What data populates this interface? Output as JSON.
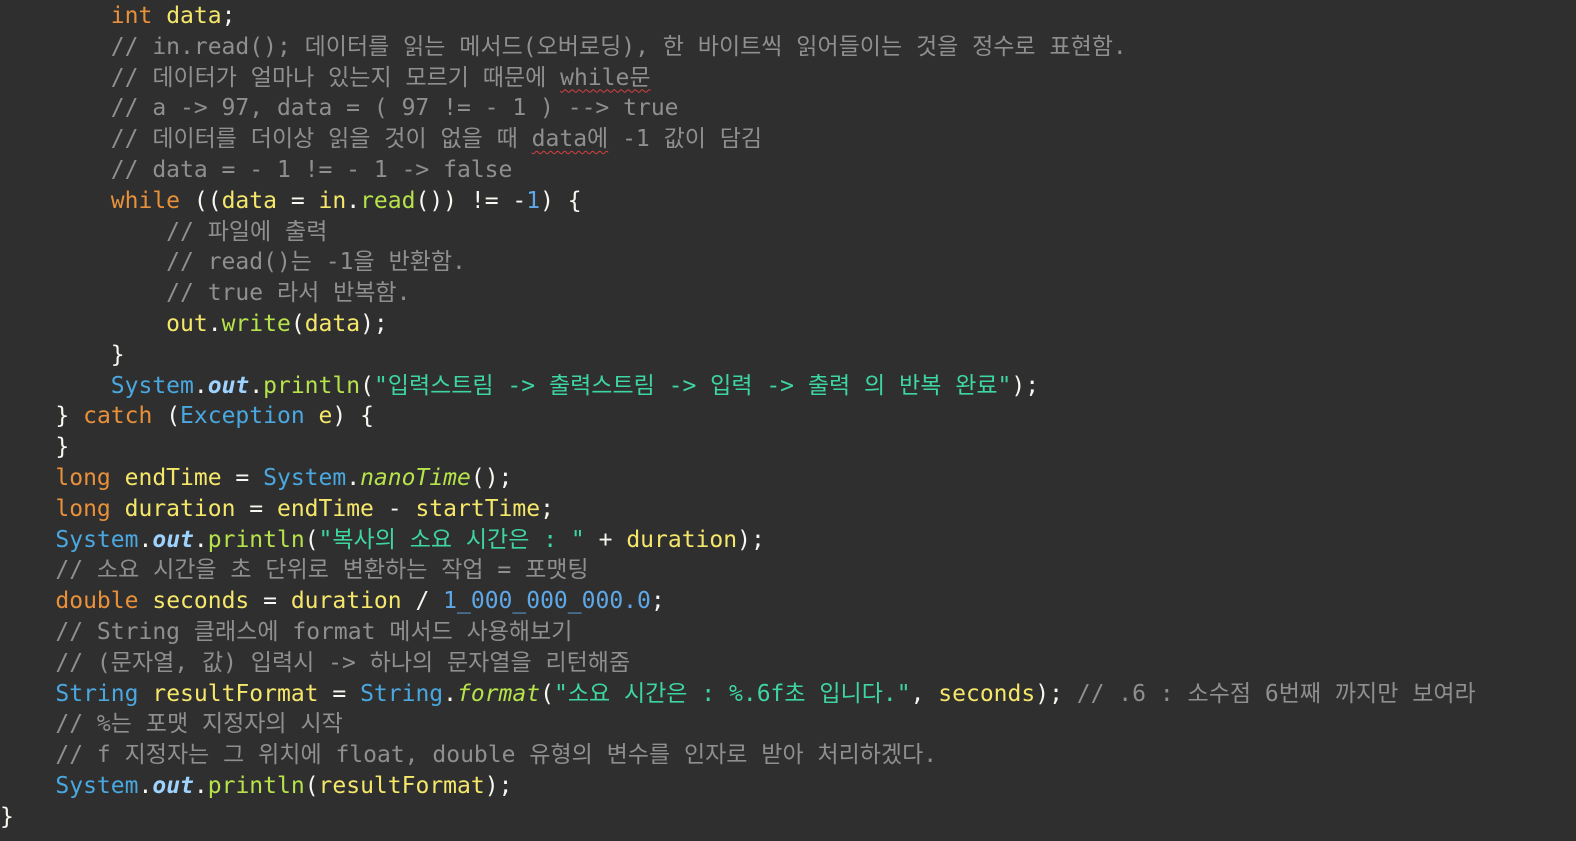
{
  "editor": {
    "lines": [
      {
        "indent": "        ",
        "tokens": [
          {
            "t": "int",
            "c": "kw"
          },
          {
            "t": " ",
            "c": "punc"
          },
          {
            "t": "data",
            "c": "var"
          },
          {
            "t": ";",
            "c": "punc"
          }
        ]
      },
      {
        "indent": "        ",
        "tokens": [
          {
            "t": "// in.read(); 데이터를 읽는 메서드(오버로딩), 한 바이트씩 읽어들이는 것을 정수로 표현함.",
            "c": "cmt"
          }
        ]
      },
      {
        "indent": "        ",
        "tokens": [
          {
            "t": "// 데이터가 얼마나 있는지 모르기 때문에 ",
            "c": "cmt"
          },
          {
            "t": "while문",
            "c": "cmt err"
          }
        ]
      },
      {
        "indent": "        ",
        "tokens": [
          {
            "t": "// a -> 97, data = ( 97 != - 1 ) --> true",
            "c": "cmt"
          }
        ]
      },
      {
        "indent": "        ",
        "tokens": [
          {
            "t": "// 데이터를 더이상 읽을 것이 없을 때 ",
            "c": "cmt"
          },
          {
            "t": "data에",
            "c": "cmt err"
          },
          {
            "t": " -1 값이 담김",
            "c": "cmt"
          }
        ]
      },
      {
        "indent": "        ",
        "tokens": [
          {
            "t": "// data = - 1 != - 1 -> false",
            "c": "cmt"
          }
        ]
      },
      {
        "indent": "        ",
        "tokens": [
          {
            "t": "while",
            "c": "kw"
          },
          {
            "t": " ((",
            "c": "punc"
          },
          {
            "t": "data",
            "c": "var"
          },
          {
            "t": " = ",
            "c": "punc"
          },
          {
            "t": "in",
            "c": "var"
          },
          {
            "t": ".",
            "c": "punc"
          },
          {
            "t": "read",
            "c": "meth"
          },
          {
            "t": "()) != -",
            "c": "punc"
          },
          {
            "t": "1",
            "c": "num"
          },
          {
            "t": ") {",
            "c": "punc"
          }
        ]
      },
      {
        "indent": "            ",
        "tokens": [
          {
            "t": "// 파일에 출력",
            "c": "cmt"
          }
        ]
      },
      {
        "indent": "            ",
        "tokens": [
          {
            "t": "// read()는 -1을 반환함.",
            "c": "cmt"
          }
        ]
      },
      {
        "indent": "            ",
        "tokens": [
          {
            "t": "// true 라서 반복함.",
            "c": "cmt"
          }
        ]
      },
      {
        "indent": "            ",
        "tokens": [
          {
            "t": "out",
            "c": "var"
          },
          {
            "t": ".",
            "c": "punc"
          },
          {
            "t": "write",
            "c": "meth"
          },
          {
            "t": "(",
            "c": "punc"
          },
          {
            "t": "data",
            "c": "var"
          },
          {
            "t": ");",
            "c": "punc"
          }
        ]
      },
      {
        "indent": "        ",
        "tokens": [
          {
            "t": "}",
            "c": "punc"
          }
        ]
      },
      {
        "indent": "        ",
        "tokens": [
          {
            "t": "System",
            "c": "type"
          },
          {
            "t": ".",
            "c": "punc"
          },
          {
            "t": "out",
            "c": "fld"
          },
          {
            "t": ".",
            "c": "punc"
          },
          {
            "t": "println",
            "c": "meth"
          },
          {
            "t": "(",
            "c": "punc"
          },
          {
            "t": "\"입력스트림 -> 출력스트림 -> 입력 -> 출력 의 반복 완료\"",
            "c": "str"
          },
          {
            "t": ");",
            "c": "punc"
          }
        ]
      },
      {
        "indent": "    ",
        "tokens": [
          {
            "t": "} ",
            "c": "punc"
          },
          {
            "t": "catch",
            "c": "kw"
          },
          {
            "t": " (",
            "c": "punc"
          },
          {
            "t": "Exception",
            "c": "type"
          },
          {
            "t": " ",
            "c": "punc"
          },
          {
            "t": "e",
            "c": "var"
          },
          {
            "t": ") {",
            "c": "punc"
          }
        ]
      },
      {
        "indent": "    ",
        "tokens": [
          {
            "t": "}",
            "c": "punc"
          }
        ]
      },
      {
        "indent": "    ",
        "tokens": [
          {
            "t": "long",
            "c": "kw"
          },
          {
            "t": " ",
            "c": "punc"
          },
          {
            "t": "endTime",
            "c": "var"
          },
          {
            "t": " = ",
            "c": "punc"
          },
          {
            "t": "System",
            "c": "type"
          },
          {
            "t": ".",
            "c": "punc"
          },
          {
            "t": "nanoTime",
            "c": "smeth"
          },
          {
            "t": "();",
            "c": "punc"
          }
        ]
      },
      {
        "indent": "    ",
        "tokens": [
          {
            "t": "long",
            "c": "kw"
          },
          {
            "t": " ",
            "c": "punc"
          },
          {
            "t": "duration",
            "c": "var"
          },
          {
            "t": " = ",
            "c": "punc"
          },
          {
            "t": "endTime",
            "c": "var"
          },
          {
            "t": " - ",
            "c": "punc"
          },
          {
            "t": "startTime",
            "c": "var"
          },
          {
            "t": ";",
            "c": "punc"
          }
        ]
      },
      {
        "indent": "    ",
        "tokens": [
          {
            "t": "System",
            "c": "type"
          },
          {
            "t": ".",
            "c": "punc"
          },
          {
            "t": "out",
            "c": "fld"
          },
          {
            "t": ".",
            "c": "punc"
          },
          {
            "t": "println",
            "c": "meth"
          },
          {
            "t": "(",
            "c": "punc"
          },
          {
            "t": "\"복사의 소요 시간은 : \"",
            "c": "str"
          },
          {
            "t": " + ",
            "c": "punc"
          },
          {
            "t": "duration",
            "c": "var"
          },
          {
            "t": ");",
            "c": "punc"
          }
        ]
      },
      {
        "indent": "    ",
        "tokens": [
          {
            "t": "// 소요 시간을 초 단위로 변환하는 작업 = 포맷팅",
            "c": "cmt"
          }
        ]
      },
      {
        "indent": "    ",
        "tokens": [
          {
            "t": "double",
            "c": "kw"
          },
          {
            "t": " ",
            "c": "punc"
          },
          {
            "t": "seconds",
            "c": "var"
          },
          {
            "t": " = ",
            "c": "punc"
          },
          {
            "t": "duration",
            "c": "var"
          },
          {
            "t": " / ",
            "c": "punc"
          },
          {
            "t": "1_000_000_000.0",
            "c": "num"
          },
          {
            "t": ";",
            "c": "punc"
          }
        ]
      },
      {
        "indent": "    ",
        "tokens": [
          {
            "t": "// String 클래스에 format 메서드 사용해보기",
            "c": "cmt"
          }
        ]
      },
      {
        "indent": "    ",
        "tokens": [
          {
            "t": "// (문자열, 값) 입력시 -> 하나의 문자열을 리턴해줌",
            "c": "cmt"
          }
        ]
      },
      {
        "indent": "    ",
        "tokens": [
          {
            "t": "String",
            "c": "type"
          },
          {
            "t": " ",
            "c": "punc"
          },
          {
            "t": "resultFormat",
            "c": "var"
          },
          {
            "t": " = ",
            "c": "punc"
          },
          {
            "t": "String",
            "c": "type"
          },
          {
            "t": ".",
            "c": "punc"
          },
          {
            "t": "format",
            "c": "smeth"
          },
          {
            "t": "(",
            "c": "punc"
          },
          {
            "t": "\"소요 시간은 : %.6f초 입니다.\"",
            "c": "str"
          },
          {
            "t": ", ",
            "c": "punc"
          },
          {
            "t": "seconds",
            "c": "var"
          },
          {
            "t": "); ",
            "c": "punc"
          },
          {
            "t": "// .6 : 소수점 6번째 까지만 보여라",
            "c": "cmt"
          }
        ]
      },
      {
        "indent": "    ",
        "tokens": [
          {
            "t": "// %는 포맷 지정자의 시작",
            "c": "cmt"
          }
        ]
      },
      {
        "indent": "    ",
        "tokens": [
          {
            "t": "// f 지정자는 그 위치에 float, double 유형의 변수를 인자로 받아 처리하겠다.",
            "c": "cmt"
          }
        ]
      },
      {
        "indent": "    ",
        "tokens": [
          {
            "t": "System",
            "c": "type"
          },
          {
            "t": ".",
            "c": "punc"
          },
          {
            "t": "out",
            "c": "fld"
          },
          {
            "t": ".",
            "c": "punc"
          },
          {
            "t": "println",
            "c": "meth"
          },
          {
            "t": "(",
            "c": "punc"
          },
          {
            "t": "resultFormat",
            "c": "var"
          },
          {
            "t": ");",
            "c": "punc"
          }
        ]
      },
      {
        "indent": "",
        "tokens": [
          {
            "t": "}",
            "c": "punc"
          }
        ]
      }
    ]
  },
  "colors": {
    "background": "#2f2f2f",
    "keyword": "#e8913a",
    "variable": "#f5e76a",
    "comment": "#8f8f8f",
    "type": "#4aa8e0",
    "method": "#b6e34b",
    "string": "#3ed6a0",
    "number": "#5fa8e8",
    "spellcheck_underline": "#d64040"
  }
}
